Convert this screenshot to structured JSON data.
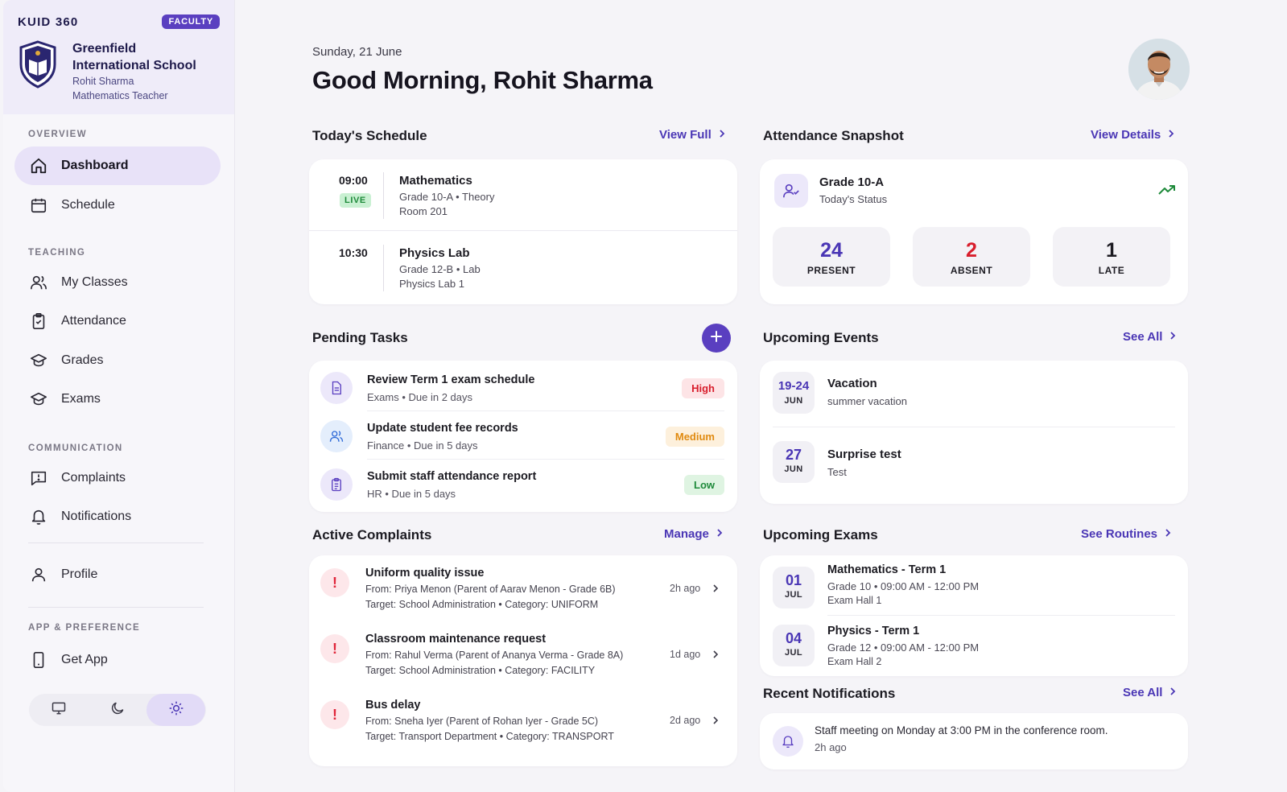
{
  "sidebar": {
    "brand": "KUID 360",
    "badge": "FACULTY",
    "school_line1": "Greenfield",
    "school_line2": "International School",
    "user_name": "Rohit Sharma",
    "user_role": "Mathematics Teacher",
    "sections": {
      "overview": "OVERVIEW",
      "teaching": "TEACHING",
      "communication": "COMMUNICATION",
      "app": "APP & PREFERENCE"
    },
    "items": {
      "dashboard": "Dashboard",
      "schedule": "Schedule",
      "my_classes": "My Classes",
      "attendance": "Attendance",
      "grades": "Grades",
      "exams": "Exams",
      "complaints": "Complaints",
      "notifications": "Notifications",
      "profile": "Profile",
      "get_app": "Get App"
    },
    "theme_selected": "light"
  },
  "header": {
    "date": "Sunday, 21 June",
    "greeting": "Good Morning, Rohit Sharma"
  },
  "schedule": {
    "title": "Today's Schedule",
    "link": "View Full",
    "items": [
      {
        "time": "09:00",
        "live": "LIVE",
        "subject": "Mathematics",
        "meta1": "Grade 10-A • Theory",
        "meta2": "Room 201"
      },
      {
        "time": "10:30",
        "subject": "Physics Lab",
        "meta1": "Grade 12-B • Lab",
        "meta2": "Physics Lab 1"
      }
    ]
  },
  "attendance": {
    "title": "Attendance Snapshot",
    "link": "View Details",
    "class": "Grade 10-A",
    "status": "Today's Status",
    "present": {
      "value": "24",
      "label": "PRESENT"
    },
    "absent": {
      "value": "2",
      "label": "ABSENT"
    },
    "late": {
      "value": "1",
      "label": "LATE"
    }
  },
  "tasks": {
    "title": "Pending Tasks",
    "items": [
      {
        "title": "Review Term 1 exam schedule",
        "meta": "Exams • Due in 2 days",
        "priority": "High"
      },
      {
        "title": "Update student fee records",
        "meta": "Finance • Due in 5 days",
        "priority": "Medium"
      },
      {
        "title": "Submit staff attendance report",
        "meta": "HR • Due in 5 days",
        "priority": "Low"
      }
    ]
  },
  "events": {
    "title": "Upcoming Events",
    "link": "See All",
    "items": [
      {
        "day": "19-24",
        "month": "JUN",
        "title": "Vacation",
        "sub": "summer vacation"
      },
      {
        "day": "27",
        "month": "JUN",
        "title": "Surprise test",
        "sub": "Test"
      }
    ]
  },
  "complaints": {
    "title": "Active Complaints",
    "link": "Manage",
    "items": [
      {
        "title": "Uniform quality issue",
        "from": "From: Priya Menon (Parent of Aarav Menon - Grade 6B)",
        "target": "Target: School Administration • Category: UNIFORM",
        "time": "2h ago"
      },
      {
        "title": "Classroom maintenance request",
        "from": "From: Rahul Verma (Parent of Ananya Verma - Grade 8A)",
        "target": "Target: School Administration • Category: FACILITY",
        "time": "1d ago"
      },
      {
        "title": "Bus delay",
        "from": "From: Sneha Iyer (Parent of Rohan Iyer - Grade 5C)",
        "target": "Target: Transport Department • Category: TRANSPORT",
        "time": "2d ago"
      }
    ]
  },
  "exams": {
    "title": "Upcoming Exams",
    "link": "See Routines",
    "items": [
      {
        "day": "01",
        "month": "JUL",
        "title": "Mathematics - Term 1",
        "meta1": "Grade 10 • 09:00 AM - 12:00 PM",
        "meta2": "Exam Hall 1"
      },
      {
        "day": "04",
        "month": "JUL",
        "title": "Physics - Term 1",
        "meta1": "Grade 12 • 09:00 AM - 12:00 PM",
        "meta2": "Exam Hall 2"
      }
    ]
  },
  "notifications": {
    "title": "Recent Notifications",
    "link": "See All",
    "items": [
      {
        "text": "Staff meeting on Monday at 3:00 PM in the conference room.",
        "time": "2h ago"
      }
    ]
  },
  "colors": {
    "accent": "#5a3fc0",
    "link": "#4a36b5",
    "present": "#4a36b5",
    "absent": "#d81e2c",
    "late": "#1c1b22",
    "high_bg": "#fde4e6",
    "high_fg": "#d81e2c",
    "medium_bg": "#fdf0dc",
    "medium_fg": "#e08a10",
    "low_bg": "#dff4e2",
    "low_fg": "#1e8a3a"
  }
}
